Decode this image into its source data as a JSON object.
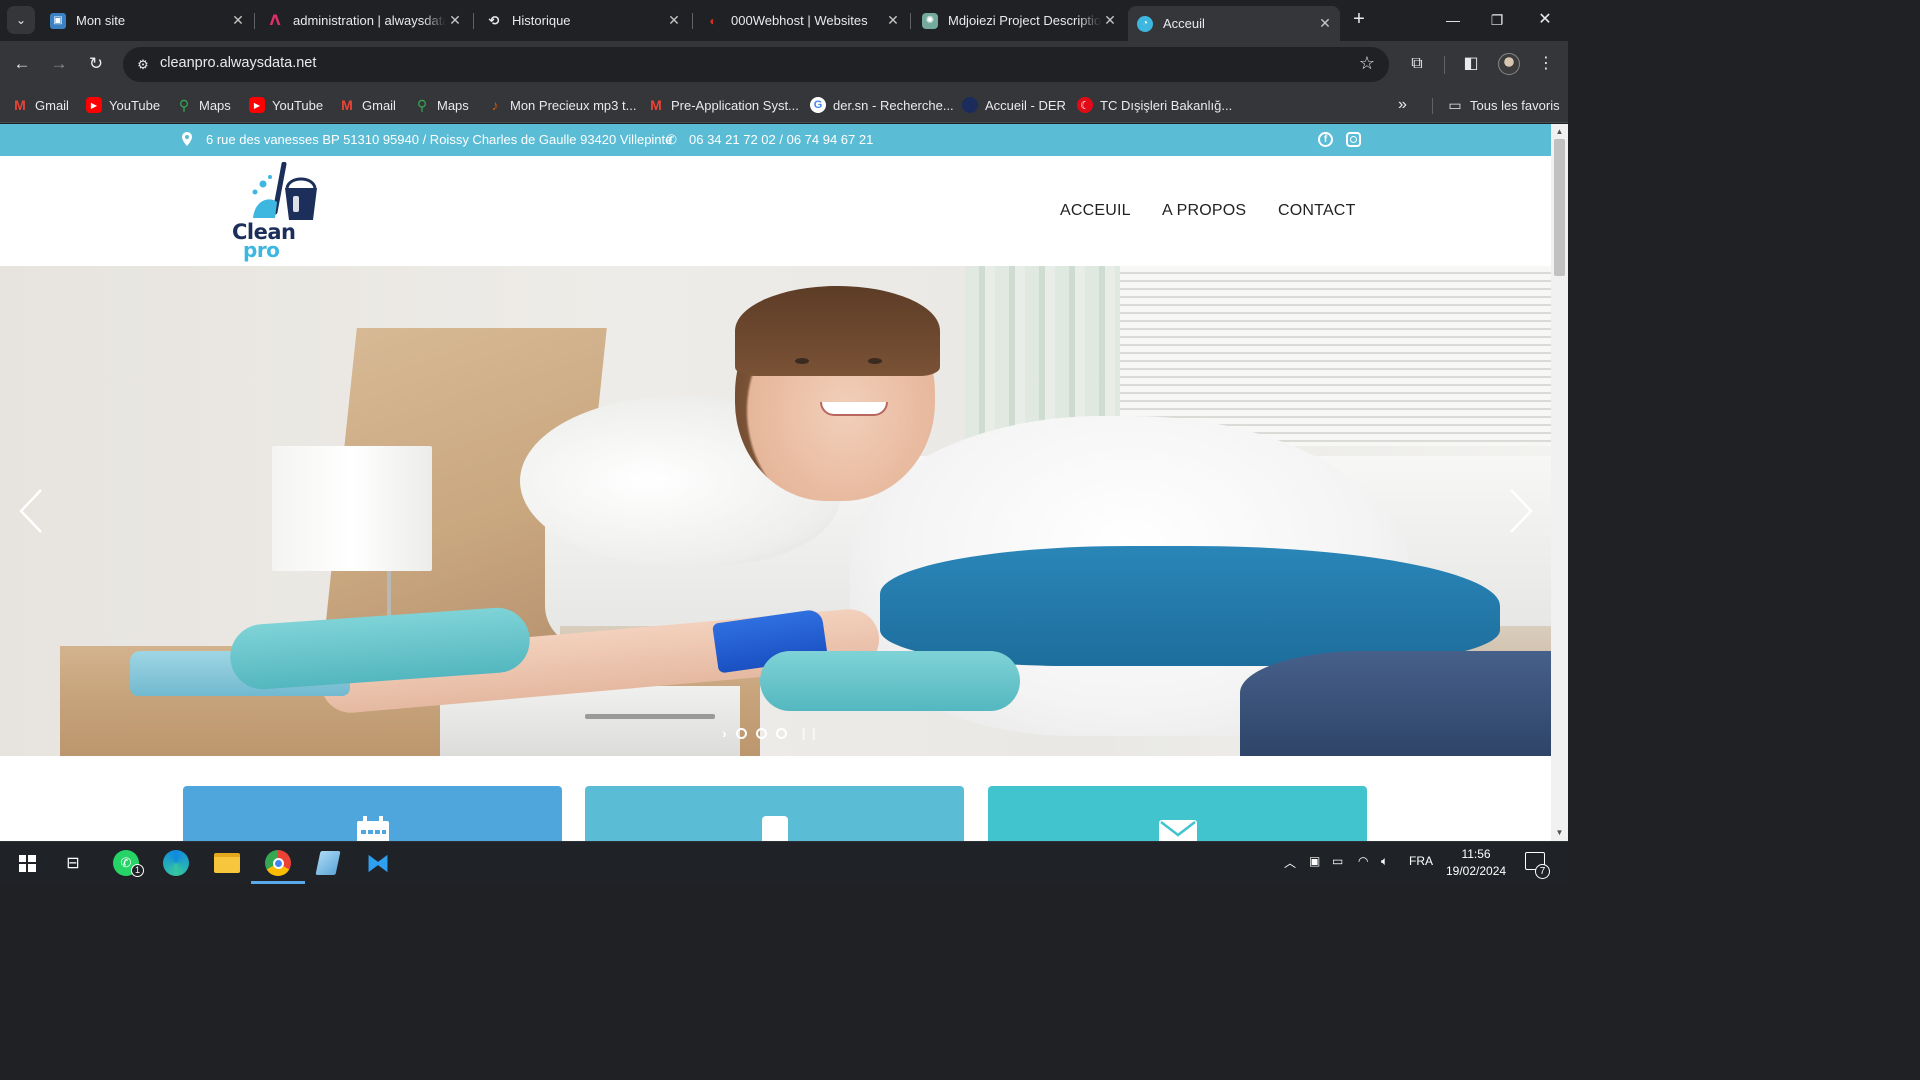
{
  "browser": {
    "tabs": [
      {
        "title": "Mon site",
        "favicon": "site-favicon"
      },
      {
        "title": "administration | alwaysdata",
        "favicon": "alwaysdata-favicon"
      },
      {
        "title": "Historique",
        "favicon": "history-icon"
      },
      {
        "title": "000Webhost | Websites",
        "favicon": "000webhost-favicon"
      },
      {
        "title": "Mdjoiezi Project Descriptio",
        "favicon": "chatgpt-favicon"
      },
      {
        "title": "Acceuil",
        "favicon": "cleanpro-favicon",
        "active": true
      }
    ],
    "address": "cleanpro.alwaysdata.net",
    "bookmarks": [
      {
        "label": "Gmail",
        "icon": "gmail-icon"
      },
      {
        "label": "YouTube",
        "icon": "youtube-icon"
      },
      {
        "label": "Maps",
        "icon": "maps-icon"
      },
      {
        "label": "YouTube",
        "icon": "youtube-icon"
      },
      {
        "label": "Gmail",
        "icon": "gmail-icon"
      },
      {
        "label": "Maps",
        "icon": "maps-icon"
      },
      {
        "label": "Mon Precieux mp3 t...",
        "icon": "mp3-icon"
      },
      {
        "label": "Pre-Application Syst...",
        "icon": "gmail-icon"
      },
      {
        "label": "der.sn - Recherche...",
        "icon": "google-icon"
      },
      {
        "label": "Accueil - DER",
        "icon": "der-icon"
      },
      {
        "label": "TC Dışişleri Bakanlığ...",
        "icon": "turkey-mfa-icon"
      }
    ],
    "all_bookmarks": "Tous les favoris"
  },
  "site": {
    "topbar": {
      "address": "6 rue des vanesses BP 51310 95940 / Roissy Charles de Gaulle 93420 Villepinte",
      "phone": "06 34 21 72 02 / 06 74 94 67 21"
    },
    "logo": {
      "line1": "Clean",
      "line2": "pro"
    },
    "nav": [
      "ACCEUIL",
      "A PROPOS",
      "CONTACT"
    ],
    "carousel": {
      "slides": 3,
      "active": 0
    },
    "cards": [
      {
        "icon": "calendar-icon",
        "color": "#4fa6dc"
      },
      {
        "icon": "mobile-icon",
        "color": "#5bbcd6"
      },
      {
        "icon": "envelope-icon",
        "color": "#42c4cf"
      }
    ]
  },
  "taskbar": {
    "apps": [
      "start-button",
      "task-view",
      "whatsapp",
      "edge",
      "file-explorer",
      "chrome",
      "notepad",
      "vscode"
    ],
    "whatsapp_badge": "1",
    "language": "FRA",
    "time": "11:56",
    "date": "19/02/2024",
    "notifications": "7"
  },
  "colors": {
    "topbar": "#5bbcd6",
    "brand_dark": "#1c2f5a",
    "brand_light": "#3eb7e0"
  }
}
